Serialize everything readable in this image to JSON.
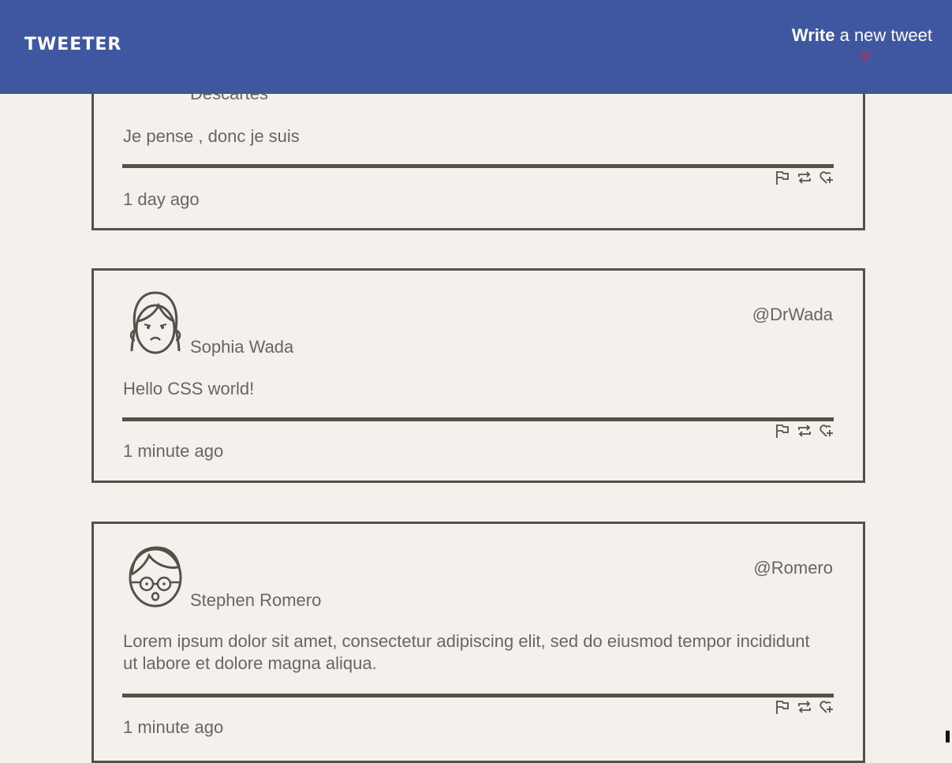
{
  "nav": {
    "brand": "TWEETER",
    "compose_strong": "Write",
    "compose_light": "a new tweet",
    "background": "#3f56a1"
  },
  "tweets": [
    {
      "name": "Descartes",
      "handle": "",
      "text": "Je pense , donc je suis",
      "time": "1 day ago"
    },
    {
      "name": "Sophia Wada",
      "handle": "@DrWada",
      "text": "Hello CSS world!",
      "time": "1 minute ago"
    },
    {
      "name": "Stephen Romero",
      "handle": "@Romero",
      "text": "Lorem ipsum dolor sit amet, consectetur adipiscing elit, sed do eiusmod tempor incididunt ut labore et dolore magna aliqua.",
      "time": "1 minute ago"
    }
  ],
  "icons": {
    "flag": "flag-icon",
    "retweet": "retweet-icon",
    "like": "heart-plus-icon",
    "compose_arrow": "double-chevron-down-icon"
  },
  "colors": {
    "page_bg": "#f4f1ec",
    "border": "#545149",
    "text": "#6a665e",
    "accent": "#c0304a"
  }
}
